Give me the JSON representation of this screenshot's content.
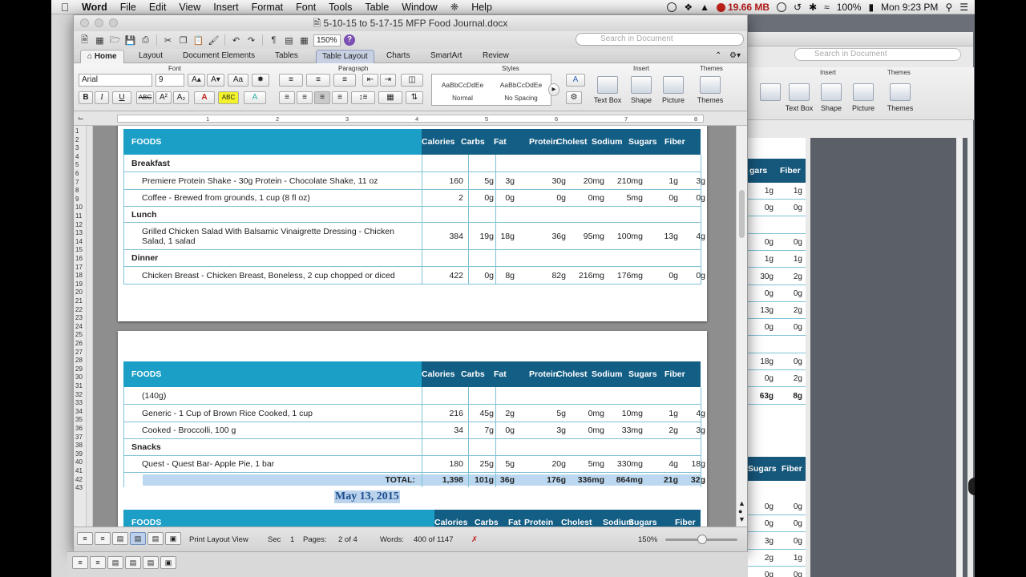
{
  "menubar": {
    "app_name": "Word",
    "items": [
      "File",
      "Edit",
      "View",
      "Insert",
      "Format",
      "Font",
      "Tools",
      "Table",
      "Window",
      "Help"
    ],
    "memory": "19.66 MB",
    "battery": "100%",
    "clock": "Mon 9:23 PM"
  },
  "window": {
    "title": "5-10-15 to 5-17-15 MFP Food Journal.docx",
    "zoom": "150%",
    "search_placeholder": "Search in Document"
  },
  "tabs": [
    "Home",
    "Layout",
    "Document Elements",
    "Tables",
    "Table Layout",
    "Charts",
    "SmartArt",
    "Review"
  ],
  "active_tab": "Table Layout",
  "ribbon": {
    "font_group": "Font",
    "paragraph_group": "Paragraph",
    "styles_group": "Styles",
    "insert_group": "Insert",
    "themes_group": "Themes",
    "font_name": "Arial",
    "font_size": "9",
    "styles": [
      {
        "preview": "AaBbCcDdEe",
        "name": "Normal"
      },
      {
        "preview": "AaBbCcDdEe",
        "name": "No Spacing"
      }
    ],
    "insert_buttons": [
      "Text Box",
      "Shape",
      "Picture"
    ],
    "themes_button": "Themes"
  },
  "ruler_marks": [
    "1",
    "2",
    "3",
    "4",
    "5",
    "6",
    "7",
    "8"
  ],
  "line_numbers": [
    "1",
    "2",
    "3",
    "4",
    "5",
    "6",
    "7",
    "8",
    "9",
    "10",
    "11",
    "12",
    "13",
    "14",
    "15",
    "16",
    "17",
    "18",
    "19",
    "20",
    "21",
    "22",
    "23",
    "24",
    "25",
    "26",
    "27",
    "28",
    "29",
    "30",
    "31",
    "32",
    "33",
    "34",
    "35",
    "36",
    "37",
    "38",
    "39",
    "40",
    "41",
    "42",
    "43"
  ],
  "table_headers": {
    "foods": "FOODS",
    "columns": [
      "Calories",
      "Carbs",
      "Fat",
      "Protein",
      "Cholest",
      "Sodium",
      "Sugars",
      "Fiber"
    ]
  },
  "page1": {
    "rows": [
      {
        "type": "section",
        "label": "Breakfast"
      },
      {
        "type": "food",
        "label": "Premiere Protein Shake - 30g Protein - Chocolate Shake, 11 oz",
        "values": [
          "160",
          "5g",
          "3g",
          "30g",
          "20mg",
          "210mg",
          "1g",
          "3g"
        ]
      },
      {
        "type": "food",
        "label": "Coffee - Brewed from grounds, 1 cup (8 fl oz)",
        "values": [
          "2",
          "0g",
          "0g",
          "0g",
          "0mg",
          "5mg",
          "0g",
          "0g"
        ]
      },
      {
        "type": "section",
        "label": "Lunch"
      },
      {
        "type": "food2",
        "label": "Grilled Chicken Salad With Balsamic Vinaigrette Dressing - Chicken",
        "label2": "Salad, 1 salad",
        "values": [
          "384",
          "19g",
          "18g",
          "36g",
          "95mg",
          "100mg",
          "13g",
          "4g"
        ]
      },
      {
        "type": "section",
        "label": "Dinner"
      },
      {
        "type": "food",
        "label": "Chicken Breast - Chicken Breast, Boneless, 2 cup chopped or diced",
        "values": [
          "422",
          "0g",
          "8g",
          "82g",
          "216mg",
          "176mg",
          "0g",
          "0g"
        ]
      }
    ]
  },
  "page2": {
    "rows": [
      {
        "type": "food",
        "label": "(140g)",
        "values": [
          "",
          "",
          "",
          "",
          "",
          "",
          "",
          ""
        ]
      },
      {
        "type": "food",
        "label": "Generic - 1 Cup of Brown Rice Cooked, 1 cup",
        "values": [
          "216",
          "45g",
          "2g",
          "5g",
          "0mg",
          "10mg",
          "1g",
          "4g"
        ]
      },
      {
        "type": "food",
        "label": "Cooked - Broccolli, 100 g",
        "values": [
          "34",
          "7g",
          "0g",
          "3g",
          "0mg",
          "33mg",
          "2g",
          "3g"
        ]
      },
      {
        "type": "section",
        "label": "Snacks"
      },
      {
        "type": "food",
        "label": "Quest - Quest Bar- Apple Pie, 1 bar",
        "values": [
          "180",
          "25g",
          "5g",
          "20g",
          "5mg",
          "330mg",
          "4g",
          "18g"
        ]
      }
    ],
    "total_label": "TOTAL:",
    "total_values": [
      "1,398",
      "101g",
      "36g",
      "176g",
      "336mg",
      "864mg",
      "21g",
      "32g"
    ],
    "date_heading": "May 13, 2015"
  },
  "status": {
    "view": "Print Layout View",
    "sec_label": "Sec",
    "sec_value": "1",
    "pages_label": "Pages:",
    "pages_value": "2 of 4",
    "words_label": "Words:",
    "words_value": "400 of 1147",
    "zoom": "150%"
  },
  "bg_window": {
    "search_placeholder": "Search in Document",
    "insert_group": "Insert",
    "themes_group": "Themes",
    "insert_buttons": [
      "Text Box",
      "Shape",
      "Picture"
    ],
    "themes_button": "Themes",
    "headers": [
      "gars",
      "Fiber"
    ],
    "headers2": [
      "Sugars",
      "Fiber"
    ],
    "rows": [
      [
        "1g",
        "1g"
      ],
      [
        "0g",
        "0g"
      ],
      [
        "",
        ""
      ],
      [
        "0g",
        "0g"
      ],
      [
        "1g",
        "1g"
      ],
      [
        "30g",
        "2g"
      ],
      [
        "0g",
        "0g"
      ],
      [
        "13g",
        "2g"
      ],
      [
        "0g",
        "0g"
      ],
      [
        "",
        ""
      ],
      [
        "18g",
        "0g"
      ],
      [
        "0g",
        "2g"
      ],
      [
        "63g",
        "8g"
      ]
    ],
    "rows2": [
      [
        "0g",
        "0g"
      ],
      [
        "0g",
        "0g"
      ],
      [
        "3g",
        "0g"
      ],
      [
        "2g",
        "1g"
      ],
      [
        "0g",
        "0g"
      ]
    ]
  }
}
